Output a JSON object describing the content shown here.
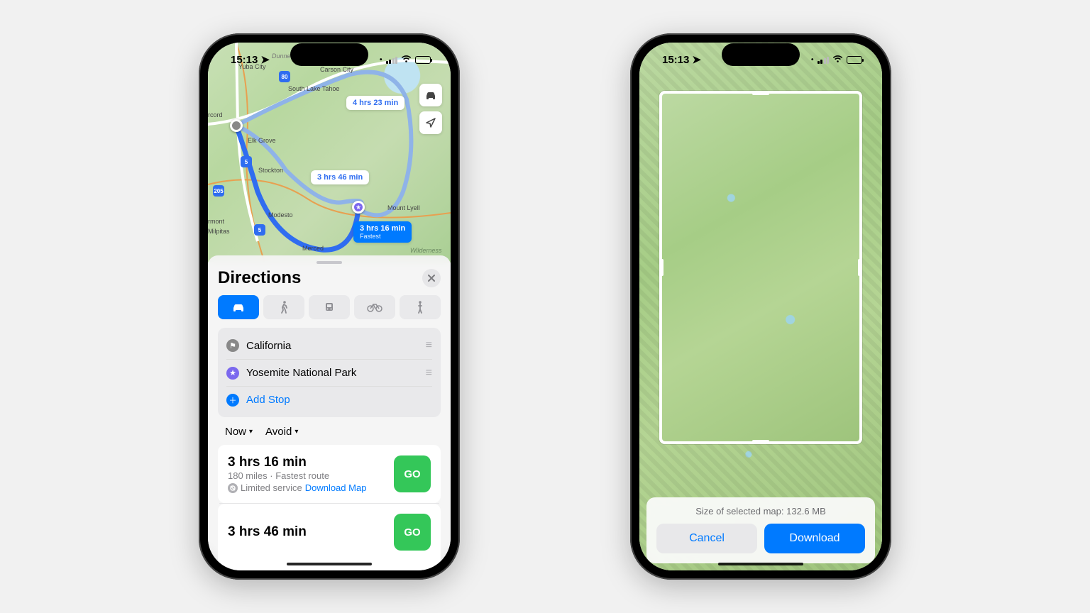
{
  "status": {
    "time": "15:13"
  },
  "left": {
    "callouts": {
      "alt1": "4 hrs 23 min",
      "alt2": "3 hrs 46 min",
      "main_time": "3 hrs 16 min",
      "main_sub": "Fastest"
    },
    "cities": {
      "yuba": "Yuba City",
      "carson": "Carson City",
      "tahoe": "South Lake Tahoe",
      "elk": "Elk Grove",
      "stockton": "Stockton",
      "modesto": "Modesto",
      "merced": "Merced",
      "lyell": "Mount Lyell",
      "milpitas": "Milpitas",
      "rmont": "rmont",
      "rcord": "rcord",
      "dunner": "Dunner Pass",
      "wilderness": "Wilderness"
    },
    "shields": {
      "i80": "80",
      "i5a": "5",
      "i5b": "5",
      "r205": "205"
    },
    "sheet": {
      "title": "Directions",
      "stops": {
        "origin": "California",
        "dest": "Yosemite National Park",
        "add": "Add Stop"
      },
      "pills": {
        "now": "Now",
        "avoid": "Avoid"
      },
      "routes": [
        {
          "time": "3 hrs 16 min",
          "sub": "180 miles · Fastest route",
          "note": "Limited service",
          "link": "Download Map",
          "go": "GO"
        },
        {
          "time": "3 hrs 46 min",
          "go": "GO"
        }
      ]
    }
  },
  "right": {
    "size_label": "Size of selected map: 132.6 MB",
    "cancel": "Cancel",
    "download": "Download"
  }
}
